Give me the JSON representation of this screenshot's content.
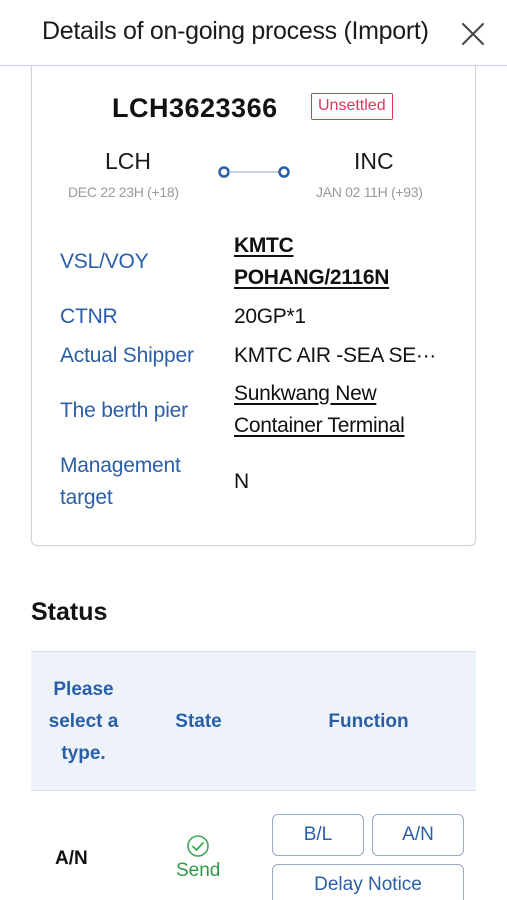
{
  "header": {
    "title": "Details of on-going process (Import)"
  },
  "shipment": {
    "bl_no": "LCH3623366",
    "badge": "Unsettled",
    "pol": {
      "code": "LCH",
      "eta": "DEC 22 23H (+18)"
    },
    "pod": {
      "code": "INC",
      "eta": "JAN 02 11H (+93)"
    }
  },
  "details": {
    "vsl_label": "VSL/VOY",
    "vsl_line1": "KMTC",
    "vsl_line2": "POHANG/2116N",
    "ctnr_label": "CTNR",
    "ctnr_value": "20GP*1",
    "shipper_label": "Actual Shipper",
    "shipper_value": "KMTC AIR -SEA SE···",
    "berth_label": "The berth pier",
    "berth_line1": "Sunkwang New",
    "berth_line2": "Container Terminal",
    "mgmt_label_line1": "Management",
    "mgmt_label_line2": "target",
    "mgmt_value": "N"
  },
  "status": {
    "title": "Status",
    "columns": {
      "type_line1": "Please",
      "type_line2": "select a",
      "type_line3": "type.",
      "state": "State",
      "function": "Function"
    },
    "rows": [
      {
        "type": "A/N",
        "state": "Send",
        "buttons": [
          "B/L",
          "A/N",
          "Delay Notice"
        ]
      }
    ]
  },
  "colors": {
    "label_blue": "#2a5fa8",
    "badge_red": "#d9385a",
    "send_green": "#2e9a45",
    "table_head_bg": "#eef3fa"
  }
}
